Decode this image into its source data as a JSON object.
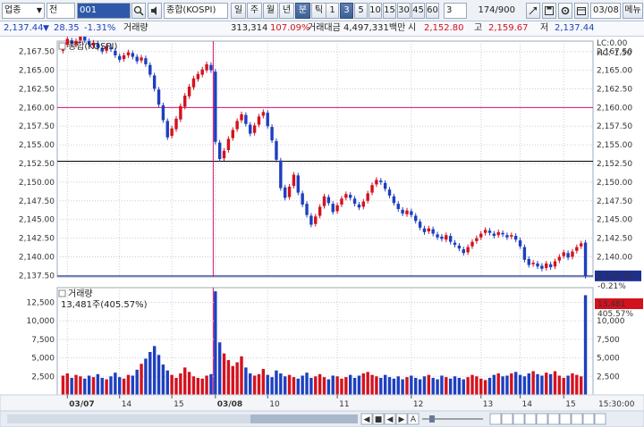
{
  "toolbar": {
    "market_type": "업종",
    "market_dropdown": "▼",
    "kind": "전",
    "code": "001",
    "name": "종합(KOSPI)",
    "periods": [
      "일",
      "주",
      "월",
      "년",
      "분",
      "틱"
    ],
    "active_period": "분",
    "minutes": [
      "1",
      "3",
      "5",
      "10",
      "15",
      "30",
      "45",
      "60"
    ],
    "active_minute": "3",
    "interval_value": "3",
    "count": "174/900",
    "date": "03/08",
    "menu_label": "메뉴"
  },
  "infobar": {
    "price": "2,137.44",
    "change": "28.35",
    "change_pct": "-1.31%",
    "volume_label": "거래량",
    "volume": "313,314",
    "volume_pct": "107.09%",
    "amount_label": "거래대금",
    "amount": "4,497,331백만",
    "open_label": "시",
    "open": "2,152.80",
    "high_label": "고",
    "high": "2,159.67",
    "low_label": "저",
    "low": "2,137.44"
  },
  "chart_data": {
    "type": "candlestick",
    "price_pane": {
      "title": "종합(KOSPI)",
      "ylim": [
        2168.9,
        2137.3
      ],
      "yticks": [
        "2,170.00",
        "2,167.50",
        "2,165.00",
        "2,162.50",
        "2,160.00",
        "2,157.50",
        "2,155.00",
        "2,152.50",
        "2,150.00",
        "2,147.50",
        "2,145.00",
        "2,142.50",
        "2,140.00",
        "2,137.50"
      ],
      "lc": "LC:0.00",
      "hc": "HC:-1.50",
      "current_price": "2,137.44",
      "current_change": "-0.21%",
      "hlines": [
        {
          "value": 2160.0,
          "color": "#d4106e"
        },
        {
          "value": 2152.8,
          "color": "#000000"
        },
        {
          "value": 2137.44,
          "color": "#1e2f8f"
        }
      ],
      "close_series": [
        2168.3,
        2169.2,
        2168.6,
        2168.9,
        2169.8,
        2169.0,
        2168.4,
        2168.7,
        2168.0,
        2167.5,
        2168.2,
        2167.8,
        2167.0,
        2166.4,
        2167.0,
        2167.4,
        2166.8,
        2166.2,
        2166.7,
        2165.8,
        2164.4,
        2162.5,
        2160.4,
        2158.3,
        2156.0,
        2157.2,
        2158.5,
        2160.2,
        2161.6,
        2162.8,
        2163.9,
        2164.5,
        2165.1,
        2165.8,
        2165.0,
        2155.4,
        2153.1,
        2154.2,
        2155.8,
        2157.0,
        2158.2,
        2159.1,
        2157.8,
        2156.5,
        2157.6,
        2158.8,
        2159.4,
        2157.5,
        2155.6,
        2153.0,
        2149.2,
        2147.9,
        2149.4,
        2151.0,
        2148.6,
        2147.0,
        2145.6,
        2144.3,
        2145.4,
        2146.7,
        2148.1,
        2147.2,
        2146.0,
        2146.9,
        2147.8,
        2148.4,
        2147.9,
        2147.1,
        2146.6,
        2147.4,
        2148.5,
        2149.6,
        2150.3,
        2150.0,
        2149.1,
        2148.2,
        2147.2,
        2146.4,
        2145.8,
        2146.2,
        2145.6,
        2144.8,
        2143.9,
        2143.3,
        2143.8,
        2143.1,
        2142.6,
        2142.4,
        2142.9,
        2142.0,
        2141.6,
        2141.1,
        2140.5,
        2141.3,
        2142.0,
        2142.5,
        2143.1,
        2143.6,
        2143.2,
        2142.8,
        2143.3,
        2143.0,
        2142.6,
        2142.9,
        2142.3,
        2141.4,
        2139.6,
        2138.9,
        2139.2,
        2138.7,
        2138.4,
        2139.1,
        2138.6,
        2139.4,
        2140.0,
        2140.6,
        2139.9,
        2140.7,
        2141.3,
        2141.8,
        2137.44
      ],
      "open_series": [
        2167.6,
        2168.4,
        2169.0,
        2168.4,
        2169.0,
        2169.6,
        2168.9,
        2168.3,
        2168.6,
        2168.0,
        2167.6,
        2168.1,
        2167.6,
        2166.9,
        2166.5,
        2167.0,
        2167.3,
        2166.8,
        2166.3,
        2166.6,
        2165.7,
        2164.3,
        2162.4,
        2160.3,
        2158.2,
        2156.2,
        2157.1,
        2158.4,
        2160.1,
        2161.5,
        2162.7,
        2163.8,
        2164.4,
        2165.0,
        2165.7,
        2164.8,
        2155.3,
        2153.2,
        2154.3,
        2155.9,
        2157.1,
        2158.3,
        2159.0,
        2157.7,
        2156.6,
        2157.7,
        2158.9,
        2159.3,
        2157.4,
        2155.5,
        2152.9,
        2149.3,
        2148.0,
        2149.5,
        2150.9,
        2148.5,
        2147.1,
        2145.5,
        2144.4,
        2145.5,
        2146.8,
        2148.0,
        2147.1,
        2146.1,
        2147.0,
        2147.9,
        2148.3,
        2147.8,
        2147.0,
        2146.7,
        2147.5,
        2148.6,
        2149.7,
        2150.2,
        2149.9,
        2149.0,
        2148.1,
        2147.1,
        2146.3,
        2145.7,
        2146.1,
        2145.5,
        2144.7,
        2143.8,
        2143.4,
        2143.7,
        2143.0,
        2142.7,
        2142.3,
        2142.8,
        2141.9,
        2141.5,
        2141.0,
        2140.6,
        2141.4,
        2142.1,
        2142.6,
        2143.2,
        2143.5,
        2143.1,
        2142.9,
        2143.2,
        2142.9,
        2142.7,
        2142.8,
        2142.2,
        2141.3,
        2139.7,
        2139.0,
        2139.1,
        2138.8,
        2138.5,
        2139.0,
        2138.7,
        2139.5,
        2140.1,
        2140.5,
        2140.0,
        2140.8,
        2141.4,
        2141.9
      ]
    },
    "volume_pane": {
      "title": "거래량",
      "subtitle": "13,481주(405.57%)",
      "ylim": [
        0,
        14500
      ],
      "yticks": [
        "12,500",
        "10,000",
        "7,500",
        "5,000",
        "2,500"
      ],
      "current_volume": "13,481",
      "current_pct": "405.57%",
      "values": [
        2600,
        2900,
        2300,
        2700,
        2500,
        2200,
        2600,
        2400,
        2800,
        2300,
        2100,
        2500,
        3000,
        2400,
        2200,
        2700,
        2600,
        3400,
        4200,
        4900,
        5800,
        6600,
        5400,
        4100,
        3300,
        2700,
        2300,
        2900,
        3700,
        3100,
        2500,
        2300,
        2200,
        2600,
        2800,
        14000,
        7100,
        5600,
        4700,
        3900,
        4400,
        5200,
        3700,
        2900,
        2600,
        2800,
        3500,
        2700,
        2400,
        3300,
        2900,
        2500,
        2700,
        2400,
        2200,
        2600,
        3000,
        2300,
        2500,
        2800,
        2400,
        2100,
        2600,
        2500,
        2200,
        2400,
        2700,
        2300,
        2600,
        2900,
        3100,
        2700,
        2500,
        2300,
        2700,
        2400,
        2200,
        2500,
        2100,
        2400,
        2600,
        2300,
        2100,
        2500,
        2700,
        2300,
        2100,
        2600,
        2400,
        2200,
        2500,
        2300,
        2100,
        2400,
        2700,
        2500,
        2200,
        2000,
        2300,
        2700,
        2900,
        2500,
        2600,
        2900,
        3100,
        2700,
        2500,
        2900,
        3200,
        2800,
        2600,
        3000,
        2800,
        3200,
        2600,
        2300,
        2600,
        2900,
        2700,
        2500,
        13481
      ]
    },
    "x_labels": [
      {
        "text": "03/07",
        "index": 1
      },
      {
        "text": "14",
        "index": 13
      },
      {
        "text": "15",
        "index": 25
      },
      {
        "text": "03/08",
        "index": 35
      },
      {
        "text": "10",
        "index": 47
      },
      {
        "text": "11",
        "index": 63
      },
      {
        "text": "12",
        "index": 80
      },
      {
        "text": "13",
        "index": 96
      },
      {
        "text": "14",
        "index": 105
      },
      {
        "text": "15",
        "index": 115
      }
    ],
    "day_separator_index": 35,
    "time_label": "15:30:00"
  },
  "colors": {
    "up": "#d4121e",
    "down": "#1e3fbf",
    "grid": "#c8d0dc",
    "separator": "#d4106e",
    "toolbar_bg": "#eef2f7",
    "active_btn": "#3c5f95"
  },
  "icons": {
    "search": "search-icon",
    "speaker": "speaker-icon",
    "settings": "gear-icon",
    "save": "save-icon",
    "calendar": "calendar-icon"
  }
}
